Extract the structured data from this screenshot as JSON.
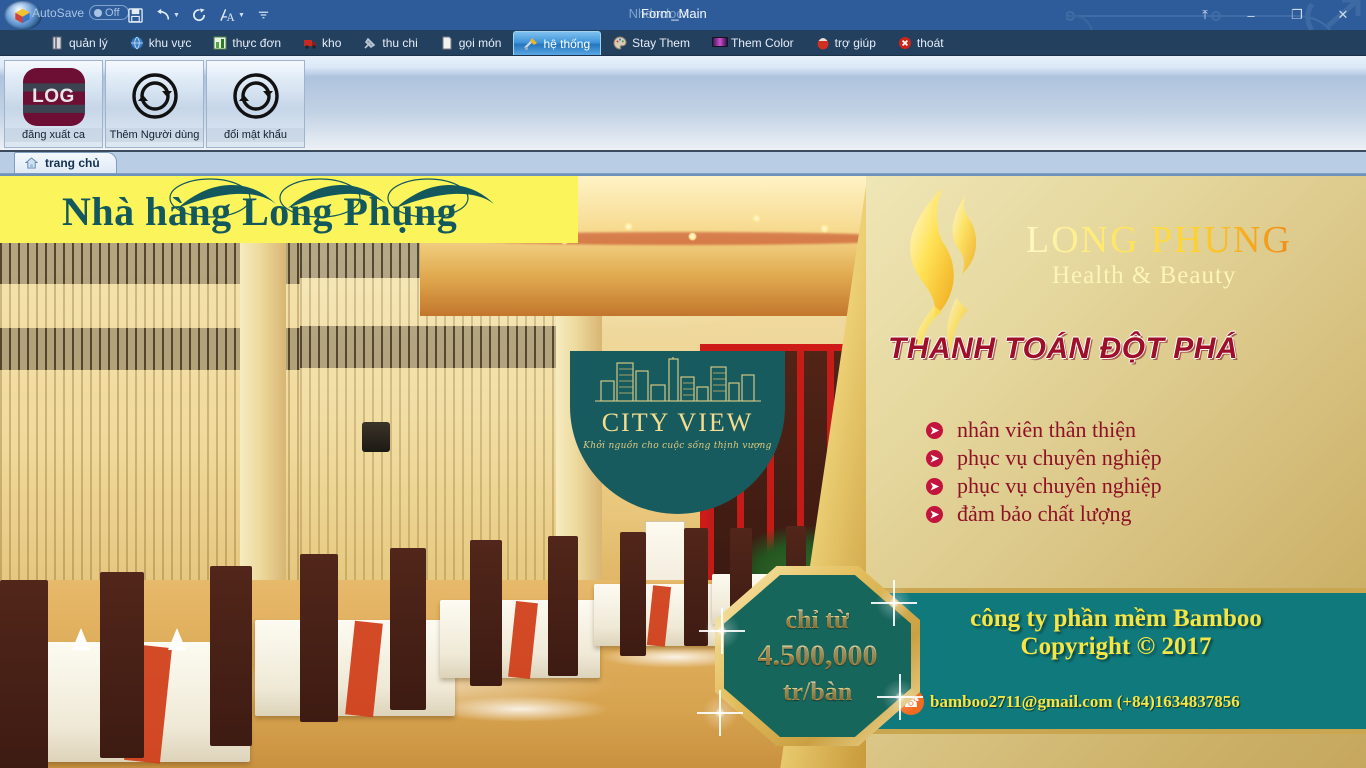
{
  "titlebar": {
    "autosave_label": "AutoSave",
    "autosave_state": "Off",
    "doc_title_ghost": "Nhdoclocx",
    "doc_title": "Form_Main",
    "qat": [
      {
        "name": "save-icon",
        "glyph": "ὋE"
      },
      {
        "name": "undo-icon",
        "glyph": "↶"
      },
      {
        "name": "redo-icon",
        "glyph": "↻"
      },
      {
        "name": "ink-icon",
        "glyph": "A"
      }
    ],
    "controls": {
      "ribbon_options": "⤒",
      "minimize": "–",
      "restore": "❐",
      "close": "✕"
    }
  },
  "menubar": {
    "items": [
      {
        "label": "quản lý",
        "icon": "book-icon",
        "active": false
      },
      {
        "label": "khu vực",
        "icon": "globe-icon",
        "active": false
      },
      {
        "label": "thực đơn",
        "icon": "chart-icon",
        "active": false
      },
      {
        "label": "kho",
        "icon": "truck-icon",
        "active": false
      },
      {
        "label": "thu chi",
        "icon": "pin-icon",
        "active": false
      },
      {
        "label": "gọi món",
        "icon": "note-icon",
        "active": false
      },
      {
        "label": "hệ thống",
        "icon": "tools-icon",
        "active": true
      },
      {
        "label": "Stay Them",
        "icon": "palette-icon",
        "active": false
      },
      {
        "label": "Them Color",
        "icon": "color-icon",
        "active": false
      },
      {
        "label": "trợ giúp",
        "icon": "help-icon",
        "active": false
      },
      {
        "label": "thoát",
        "icon": "exit-icon",
        "active": false
      }
    ]
  },
  "ribbon": {
    "buttons": [
      {
        "label": "đăng xuất ca",
        "icon": "log-icon",
        "glyph": "LOG"
      },
      {
        "label": "Thêm Người dùng",
        "icon": "refresh-circle-icon",
        "glyph": ""
      },
      {
        "label": "đổi mật khẩu",
        "icon": "refresh-circle-icon",
        "glyph": ""
      }
    ]
  },
  "tabstrip": {
    "tabs": [
      {
        "label": "trang chủ",
        "icon": "home-icon",
        "active": true
      }
    ]
  },
  "banner": {
    "restaurant_name": "Nhà hàng Long Phụng",
    "cityview": {
      "name": "CITY VIEW",
      "tagline": "Khởi nguồn cho cuộc sống thịnh vượng"
    },
    "price_badge": {
      "line1": "chỉ từ",
      "line2": "4.500,000",
      "line3": "tr/bàn"
    },
    "brand": {
      "title": "LONG PHUNG",
      "subtitle": "Health & Beauty"
    },
    "headline": "THANH TOÁN ĐỘT PHÁ",
    "bullets": [
      "nhân viên thân thiện",
      "phục vụ chuyên nghiệp",
      "phục vụ chuyên nghiệp",
      "đảm bảo chất lượng"
    ],
    "bullet_glyph": "➤",
    "footer": {
      "line1": "công ty phần mềm Bamboo",
      "line2": "Copyright © 2017",
      "contact": "bamboo2711@gmail.com (+84)1634837856",
      "phone_icon": "☎"
    }
  },
  "colors": {
    "teal": "#175b5e",
    "footer_teal": "#10797b",
    "gold": "#c9a64f",
    "yellow": "#fbf55b",
    "crimson": "#9e0f2a",
    "titlebar_blue": "#2e5c9a",
    "menubar_blue": "#24405f"
  }
}
